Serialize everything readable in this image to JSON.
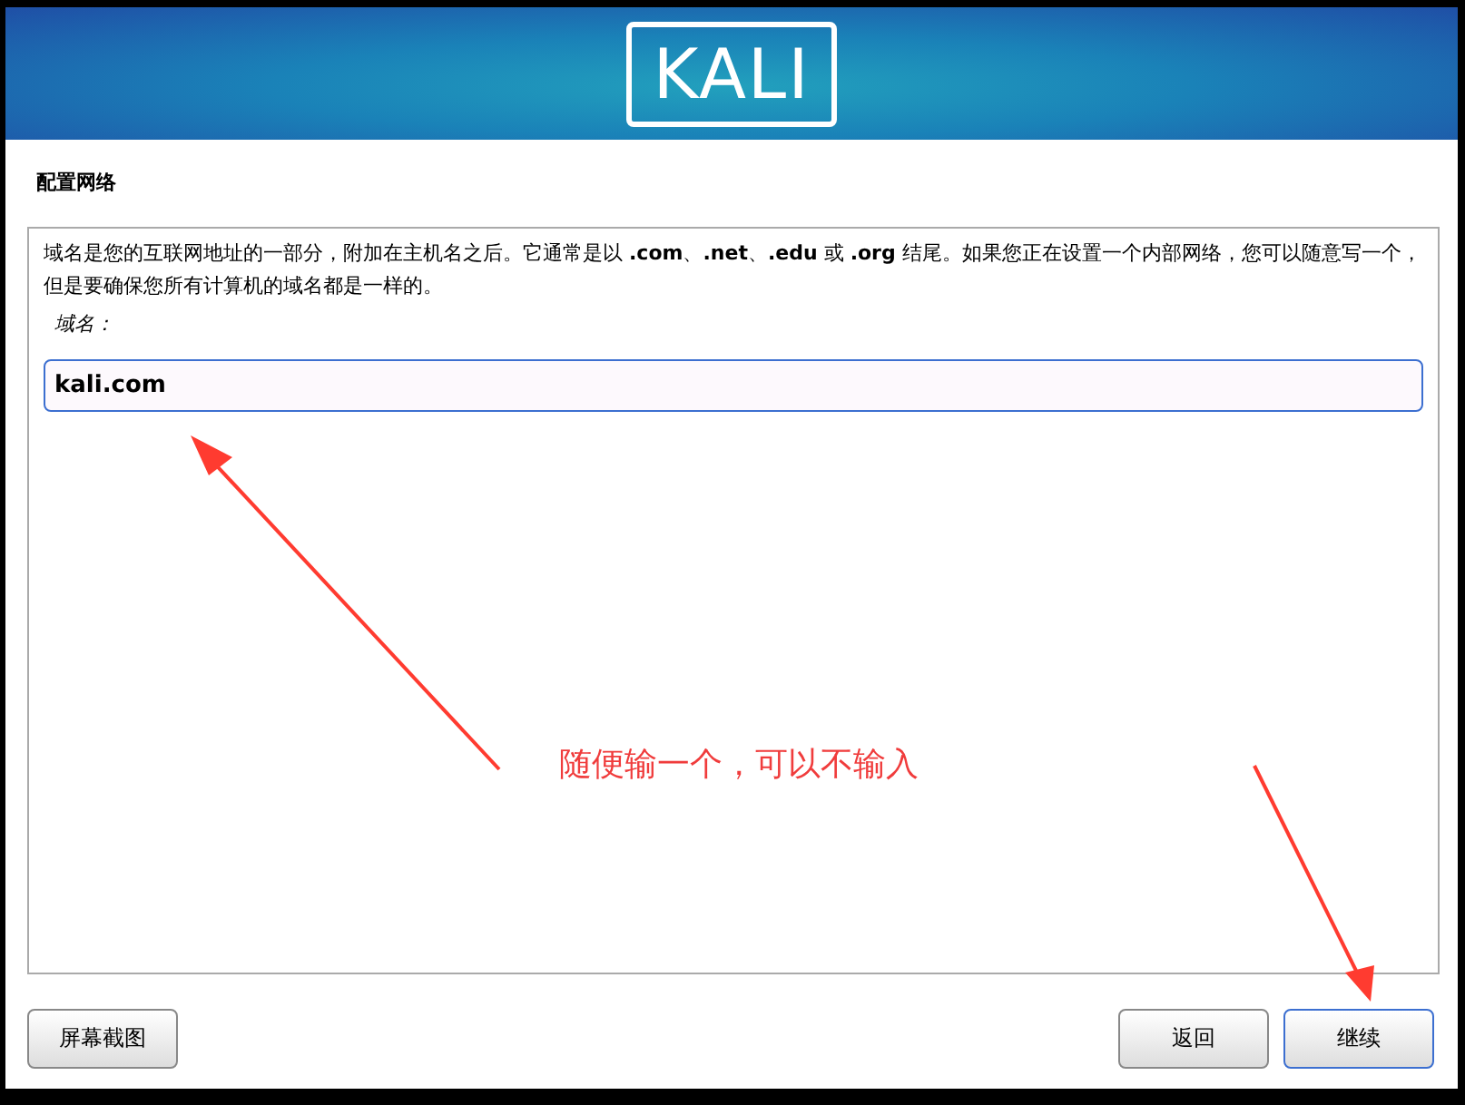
{
  "header": {
    "logo": "KALI"
  },
  "page_title": "配置网络",
  "description": "域名是您的互联网地址的一部分，附加在主机名之后。它通常是以 **.com**、**.net**、**.edu** 或 **.org** 结尾。如果您正在设置一个内部网络，您可以随意写一个，但是要确保您所有计算机的域名都是一样的。",
  "field": {
    "label": "域名：",
    "value": "kali.com"
  },
  "annotation": {
    "text": "随便输一个，可以不输入"
  },
  "buttons": [
    {
      "label": "屏幕截图",
      "kind": "left",
      "focused": false
    },
    {
      "label": "返回",
      "kind": "right",
      "focused": false
    },
    {
      "label": "继续",
      "kind": "right",
      "focused": true
    }
  ]
}
